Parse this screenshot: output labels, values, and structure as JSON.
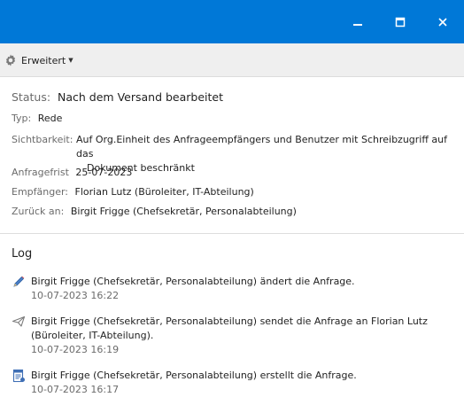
{
  "window": {
    "minimize": "minimize",
    "maximize": "maximize",
    "close": "close"
  },
  "toolbar": {
    "advanced_label": "Erweitert"
  },
  "details": {
    "status_label": "Status:",
    "status_value": "Nach dem Versand bearbeitet",
    "type_label": "Typ:",
    "type_value": "Rede",
    "visibility_label": "Sichtbarkeit:",
    "visibility_line1": "Auf Org.Einheit des Anfrageempfängers und Benutzer mit Schreibzugriff auf das",
    "visibility_line2": "Dokument beschränkt",
    "deadline_label": "Anfragefrist",
    "deadline_value": "25-07-2023",
    "recipient_label": "Empfänger:",
    "recipient_value": "Florian Lutz (Büroleiter, IT-Abteilung)",
    "return_label": "Zurück an:",
    "return_value": "Birgit Frigge (Chefsekretär, Personalabteilung)"
  },
  "log": {
    "title": "Log",
    "entries": [
      {
        "icon": "pencil-icon",
        "line1": "Birgit Frigge (Chefsekretär, Personalabteilung) ändert die Anfrage.",
        "line2": "",
        "time": "10-07-2023 16:22"
      },
      {
        "icon": "send-icon",
        "line1": "Birgit Frigge (Chefsekretär, Personalabteilung) sendet die Anfrage an Florian Lutz",
        "line2": "(Büroleiter, IT-Abteilung).",
        "time": "10-07-2023 16:19"
      },
      {
        "icon": "document-create-icon",
        "line1": "Birgit Frigge (Chefsekretär, Personalabteilung) erstellt die Anfrage.",
        "line2": "",
        "time": "10-07-2023 16:17"
      }
    ]
  },
  "colors": {
    "titlebar": "#0078d7",
    "toolbar": "#efefef",
    "muted_text": "#6b6b6b"
  }
}
